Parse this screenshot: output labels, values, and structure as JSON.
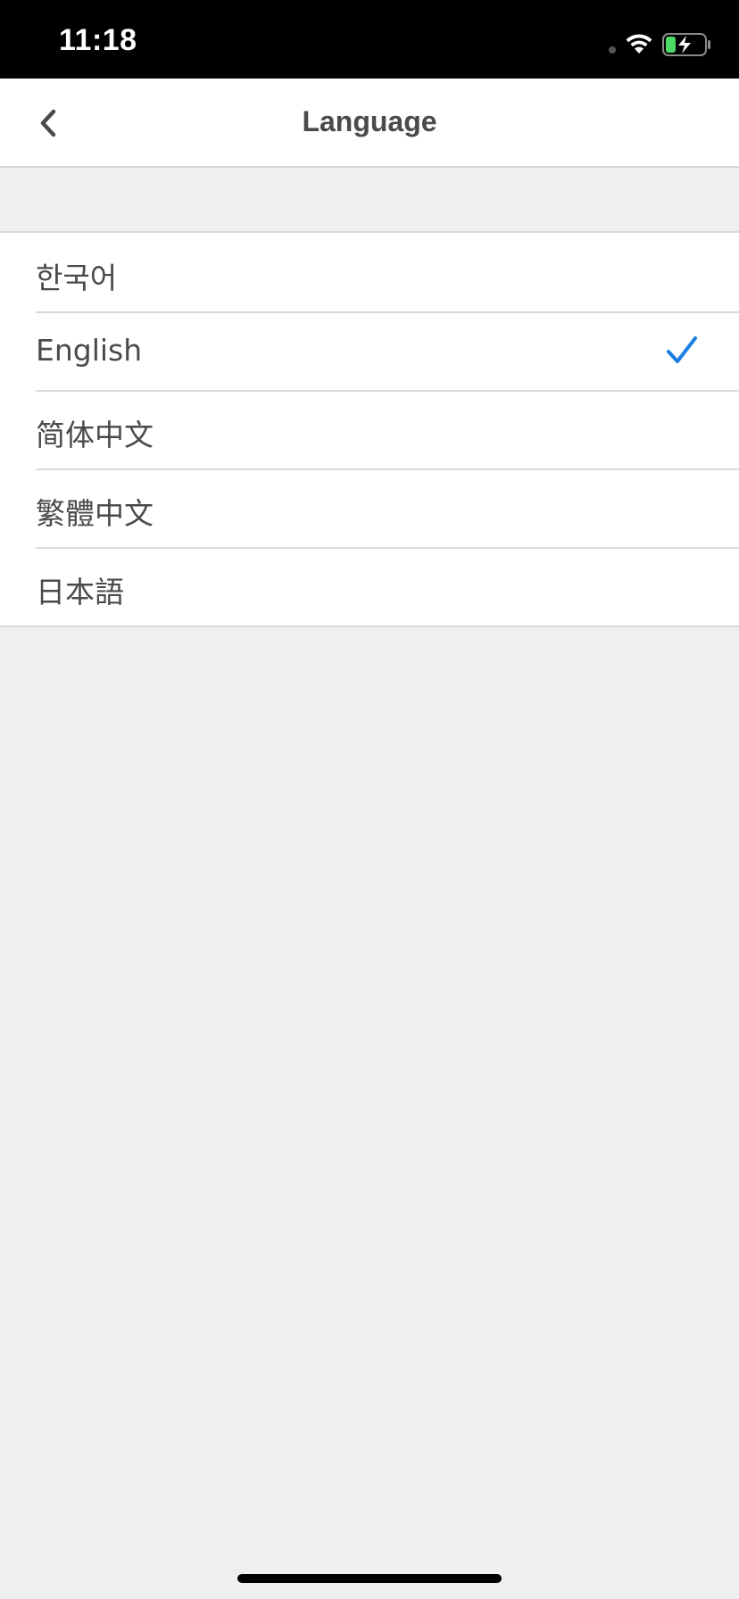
{
  "status_bar": {
    "time": "11:18"
  },
  "nav": {
    "title": "Language",
    "back_icon": "chevron-left-icon"
  },
  "languages": [
    {
      "label": "한국어",
      "selected": false
    },
    {
      "label": "English",
      "selected": true
    },
    {
      "label": "简体中文",
      "selected": false
    },
    {
      "label": "繁體中文",
      "selected": false
    },
    {
      "label": "日本語",
      "selected": false
    }
  ],
  "colors": {
    "accent": "#1a7ee0",
    "text": "#4a4a4a",
    "background": "#efefef",
    "battery_green": "#4cd964"
  }
}
